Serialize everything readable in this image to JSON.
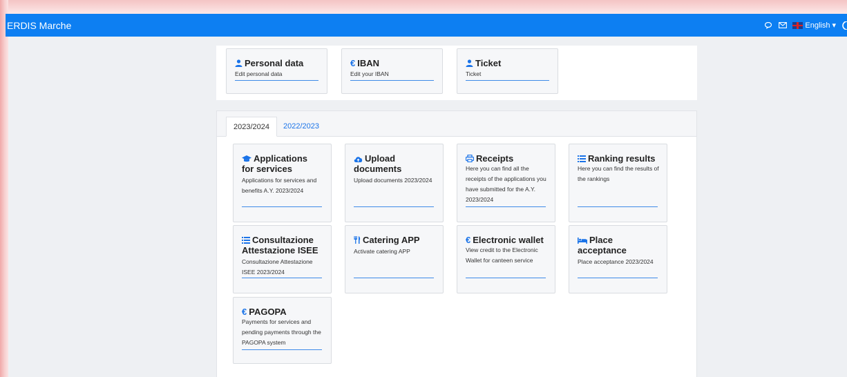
{
  "app": {
    "title": "ERDIS Marche"
  },
  "nav": {
    "language": "English"
  },
  "top_cards": [
    {
      "title": "Personal data",
      "desc": "Edit personal data",
      "icon": "user-icon"
    },
    {
      "title": "IBAN",
      "desc": "Edit your IBAN",
      "icon": "euro-icon"
    },
    {
      "title": "Ticket",
      "desc": "Ticket",
      "icon": "user-icon"
    }
  ],
  "tabs": [
    {
      "label": "2023/2024",
      "active": true
    },
    {
      "label": "2022/2023",
      "active": false
    }
  ],
  "services": [
    {
      "title_l1": "Applications",
      "title_l2": "for services",
      "desc_l1": "Applications for services and",
      "desc_l2": "benefits A.Y. 2023/2024",
      "icon": "graduation-cap-icon"
    },
    {
      "title_l1": "Upload",
      "title_l2": "documents",
      "desc_l1": "Upload documents 2023/2024",
      "icon": "cloud-upload-icon"
    },
    {
      "title_l1": "Receipts",
      "desc_l1": "Here you can find all the",
      "desc_l2": "receipts of the applications you",
      "desc_l3": "have submitted for the A.Y.",
      "desc_l4": "2023/2024",
      "icon": "printer-icon"
    },
    {
      "title_l1": "Ranking results",
      "desc_l1": "Here you can find the results of",
      "desc_l2": "the rankings",
      "icon": "list-icon"
    },
    {
      "title_l1": "Consultazione",
      "title_l2": "Attestazione ISEE",
      "desc_l1": "Consultazione Attestazione",
      "desc_l2": "ISEE 2023/2024",
      "icon": "list-icon"
    },
    {
      "title_l1": "Catering APP",
      "desc_l1": "Activate catering APP",
      "icon": "cutlery-icon"
    },
    {
      "title_l1": "Electronic wallet",
      "desc_l1": "View credit to the Electronic",
      "desc_l2": "Wallet for canteen service",
      "icon": "euro-icon"
    },
    {
      "title_l1": "Place",
      "title_l2": "acceptance",
      "desc_l1": "Place acceptance 2023/2024",
      "icon": "bed-icon"
    },
    {
      "title_l1": "PAGOPA",
      "desc_l1": "Payments for services and",
      "desc_l2": "pending payments through the",
      "desc_l3": "PAGOPA system",
      "icon": "euro-icon"
    }
  ],
  "colors": {
    "navbar": "#0d7ff2",
    "accent": "#1a73e8"
  }
}
